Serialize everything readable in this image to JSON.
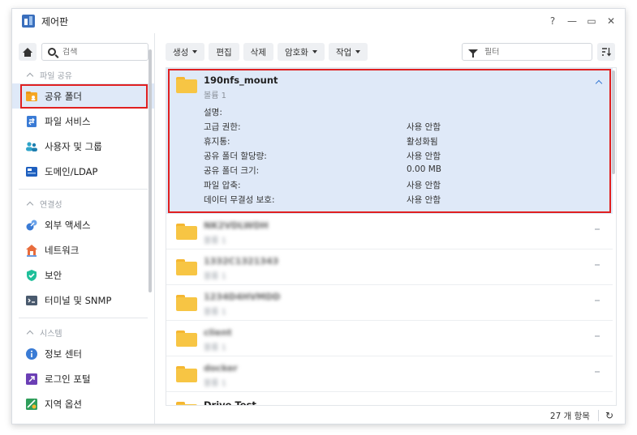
{
  "window": {
    "title": "제어판"
  },
  "controls": {
    "help": "?",
    "minimize": "—",
    "maximize": "▭",
    "close": "✕"
  },
  "sidebar": {
    "search_placeholder": "검색",
    "sections": [
      {
        "title": "파일 공유",
        "items": [
          {
            "label": "공유 폴더",
            "icon": "shared-folder-icon",
            "active": true
          },
          {
            "label": "파일 서비스",
            "icon": "file-services-icon"
          },
          {
            "label": "사용자 및 그룹",
            "icon": "users-groups-icon"
          },
          {
            "label": "도메인/LDAP",
            "icon": "domain-ldap-icon"
          }
        ]
      },
      {
        "title": "연결성",
        "items": [
          {
            "label": "외부 액세스",
            "icon": "external-access-icon"
          },
          {
            "label": "네트워크",
            "icon": "network-icon"
          },
          {
            "label": "보안",
            "icon": "security-shield-icon"
          },
          {
            "label": "터미널 및 SNMP",
            "icon": "terminal-icon"
          }
        ]
      },
      {
        "title": "시스템",
        "items": [
          {
            "label": "정보 센터",
            "icon": "info-center-icon"
          },
          {
            "label": "로그인 포털",
            "icon": "login-portal-icon"
          },
          {
            "label": "지역 옵션",
            "icon": "regional-options-icon"
          }
        ]
      }
    ]
  },
  "toolbar": {
    "create": "생성",
    "edit": "편집",
    "delete": "삭제",
    "encryption": "암호화",
    "action": "작업",
    "filter_placeholder": "필터"
  },
  "expanded": {
    "name": "190nfs_mount",
    "volume": "볼륨 1",
    "details": [
      {
        "label": "설명:",
        "value": ""
      },
      {
        "label": "고급 권한:",
        "value": "사용 안함"
      },
      {
        "label": "휴지통:",
        "value": "활성화됨"
      },
      {
        "label": "공유 폴더 할당량:",
        "value": "사용 안함"
      },
      {
        "label": "공유 폴더 크기:",
        "value": "0.00 MB"
      },
      {
        "label": "파일 압축:",
        "value": "사용 안함"
      },
      {
        "label": "데이터 무결성 보호:",
        "value": "사용 안함"
      }
    ]
  },
  "rows": [
    {
      "name": "NK2VDLWDH",
      "sub": "볼륨 1"
    },
    {
      "name": "1332C1321343",
      "sub": "볼륨 1"
    },
    {
      "name": "1234D4HVMDD",
      "sub": "볼륨 1"
    },
    {
      "name": "client",
      "sub": "볼륨 1"
    },
    {
      "name": "docker",
      "sub": "볼륨 1"
    },
    {
      "name": "Drive Test",
      "sub": ""
    }
  ],
  "status": {
    "count": "27 개 항목",
    "refresh": "↻"
  },
  "colors": {
    "accent": "#3a7bd5",
    "highlight": "#e02020",
    "selected_bg": "#dfe9f8",
    "folder": "#f7c544"
  }
}
